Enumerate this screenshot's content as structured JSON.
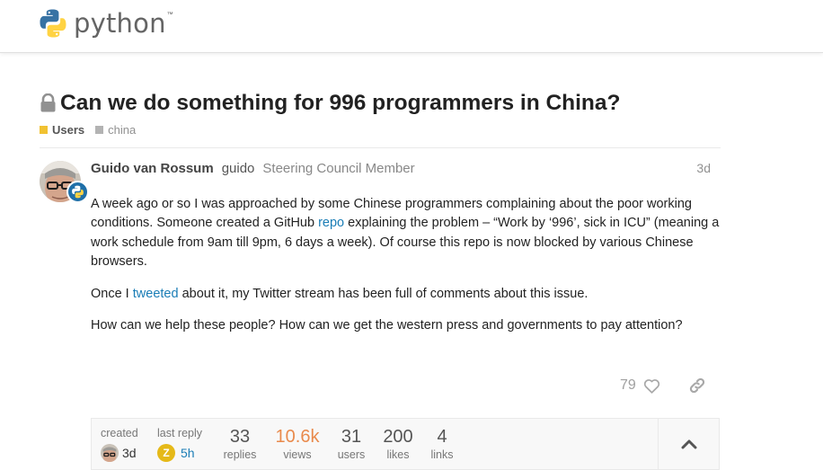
{
  "header": {
    "logo_text": "python",
    "logo_tm": "™"
  },
  "topic": {
    "title": "Can we do something for 996 programmers in China?",
    "category": {
      "name": "Users",
      "color": "#f1c232"
    },
    "tag": {
      "name": "china",
      "color": "#b3b3b3"
    }
  },
  "post": {
    "author_name": "Guido van Rossum",
    "author_username": "guido",
    "author_title": "Steering Council Member",
    "date": "3d",
    "paragraphs": [
      {
        "before": "A week ago or so I was approached by some Chinese programmers complaining about the poor working conditions. Someone created a GitHub ",
        "link": "repo",
        "after": " explaining the problem – “Work by ‘996’, sick in ICU” (meaning a work schedule from 9am till 9pm, 6 days a week). Of course this repo is now blocked by various Chinese browsers."
      },
      {
        "before": "Once I ",
        "link": "tweeted",
        "after": " about it, my Twitter stream has been full of comments about this issue."
      },
      {
        "text": "How can we help these people? How can we get the western press and governments to pay attention?"
      }
    ],
    "like_count": "79",
    "icons": {
      "like": "heart-icon",
      "share": "link-icon",
      "lock": "lock-icon",
      "badge": "python-badge-icon"
    }
  },
  "topic_map": {
    "created_label": "created",
    "created_value": "3d",
    "last_reply_label": "last reply",
    "last_reply_avatar_letter": "Z",
    "last_reply_value": "5h",
    "stats": [
      {
        "value": "33",
        "label": "replies",
        "hot": false
      },
      {
        "value": "10.6k",
        "label": "views",
        "hot": true
      },
      {
        "value": "31",
        "label": "users",
        "hot": false
      },
      {
        "value": "200",
        "label": "likes",
        "hot": false
      },
      {
        "value": "4",
        "label": "links",
        "hot": false
      }
    ],
    "toggle_icon": "chevron-up-icon"
  },
  "colors": {
    "link": "#1a7db6",
    "hot_views": "#e98a4c",
    "python_blue": "#3772a4",
    "python_yellow": "#ffd343"
  }
}
